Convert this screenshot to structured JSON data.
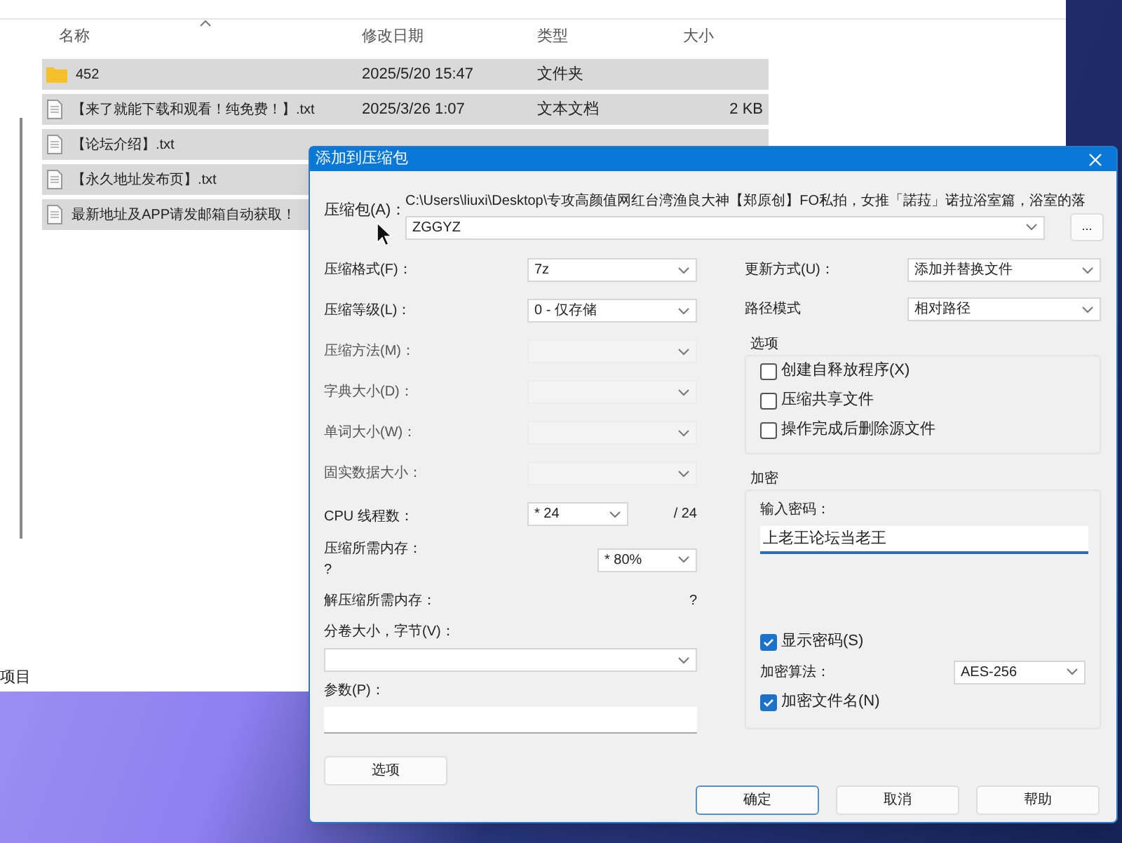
{
  "explorer": {
    "columns": [
      "名称",
      "修改日期",
      "类型",
      "大小"
    ],
    "rows": [
      {
        "kind": "folder",
        "name": "452",
        "modified": "2025/5/20 15:47",
        "type": "文件夹"
      },
      {
        "kind": "file",
        "name": "【来了就能下载和观看！纯免费！】.txt",
        "modified": "2025/3/26 1:07",
        "type": "文本文档",
        "size": "2 KB"
      },
      {
        "kind": "file",
        "name": "【论坛介绍】.txt"
      },
      {
        "kind": "file",
        "name": "【永久地址发布页】.txt"
      },
      {
        "kind": "file",
        "name": "最新地址及APP请发邮箱自动获取！"
      }
    ],
    "status": "项目"
  },
  "dialog": {
    "title": "添加到压缩包",
    "archive": {
      "label": "压缩包(A)：",
      "path": "C:\\Users\\liuxi\\Desktop\\专攻高颜值网红台湾渔良大神【郑原创】FO私拍，女推「諾菈」诺拉浴室篇，浴室的落",
      "value": "ZGGYZ",
      "browse": "..."
    },
    "left_fields": [
      {
        "kind": "select",
        "label": "压缩格式(F)：",
        "value": "7z",
        "disabled": false
      },
      {
        "kind": "select",
        "label": "压缩等级(L)：",
        "value": "0 - 仅存储",
        "disabled": false
      },
      {
        "kind": "select",
        "label": "压缩方法(M)：",
        "disabled": true
      },
      {
        "kind": "select",
        "label": "字典大小(D)：",
        "disabled": true
      },
      {
        "kind": "select",
        "label": "单词大小(W)：",
        "disabled": true
      },
      {
        "kind": "select",
        "label": "固实数据大小：",
        "disabled": true
      },
      {
        "kind": "threads",
        "label": "CPU 线程数：",
        "value": "* 24",
        "total": "/ 24"
      },
      {
        "kind": "memory",
        "label": "压缩所需内存：",
        "note": "?",
        "value": "* 80%"
      },
      {
        "kind": "info",
        "label": "解压缩所需内存：",
        "value": "?"
      },
      {
        "kind": "combo",
        "label": "分卷大小，字节(V)："
      },
      {
        "kind": "text",
        "label": "参数(P)："
      }
    ],
    "options_button": "选项",
    "update": {
      "label": "更新方式(U)：",
      "value": "添加并替换文件"
    },
    "path_mode": {
      "label": "路径模式",
      "value": "相对路径"
    },
    "options": {
      "title": "选项",
      "items": [
        {
          "label": "创建自释放程序(X)",
          "checked": false
        },
        {
          "label": "压缩共享文件",
          "checked": false
        },
        {
          "label": "操作完成后删除源文件",
          "checked": false
        }
      ]
    },
    "encryption": {
      "title": "加密",
      "password_label": "输入密码：",
      "password": "上老王论坛当老王",
      "show_password": {
        "label": "显示密码(S)",
        "checked": true
      },
      "method_label": "加密算法：",
      "method": "AES-256",
      "encrypt_names": {
        "label": "加密文件名(N)",
        "checked": true
      }
    },
    "buttons": [
      {
        "label": "确定",
        "default": true
      },
      {
        "label": "取消",
        "default": false
      },
      {
        "label": "帮助",
        "default": false
      }
    ]
  }
}
